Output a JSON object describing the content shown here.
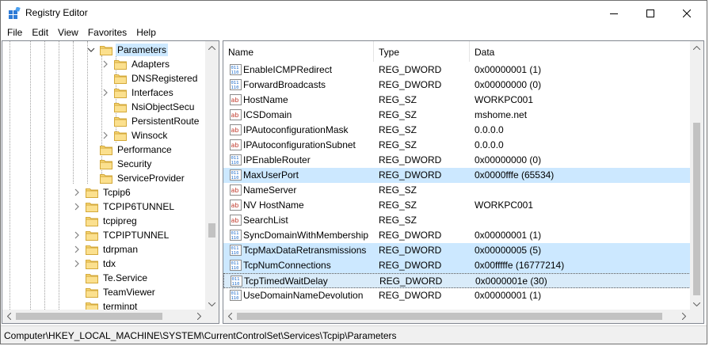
{
  "window": {
    "title": "Registry Editor"
  },
  "menubar": {
    "items": [
      {
        "accel": "F",
        "rest": "ile"
      },
      {
        "accel": "E",
        "rest": "dit"
      },
      {
        "accel": "V",
        "rest": "iew"
      },
      {
        "accel": "",
        "pre": "F",
        "accel2": "a",
        "rest": "vorites"
      },
      {
        "accel": "H",
        "rest": "elp"
      }
    ],
    "labels": [
      "File",
      "Edit",
      "View",
      "Favorites",
      "Help"
    ]
  },
  "tree": {
    "items": [
      {
        "label": "Parameters",
        "expanded": true,
        "selected": true
      },
      {
        "label": "Adapters",
        "expandable": true
      },
      {
        "label": "DNSRegistered",
        "expandable": false
      },
      {
        "label": "Interfaces",
        "expandable": true
      },
      {
        "label": "NsiObjectSecu",
        "expandable": false
      },
      {
        "label": "PersistentRoute",
        "expandable": false
      },
      {
        "label": "Winsock",
        "expandable": true
      },
      {
        "label": "Performance",
        "expandable": false
      },
      {
        "label": "Security",
        "expandable": false
      },
      {
        "label": "ServiceProvider",
        "expandable": false
      },
      {
        "label": "Tcpip6",
        "expandable": true
      },
      {
        "label": "TCPIP6TUNNEL",
        "expandable": true
      },
      {
        "label": "tcpipreg",
        "expandable": false
      },
      {
        "label": "TCPIPTUNNEL",
        "expandable": true
      },
      {
        "label": "tdrpman",
        "expandable": true
      },
      {
        "label": "tdx",
        "expandable": true
      },
      {
        "label": "Te.Service",
        "expandable": false
      },
      {
        "label": "TeamViewer",
        "expandable": false
      },
      {
        "label": "terminpt",
        "expandable": false
      }
    ]
  },
  "list": {
    "columns": [
      "Name",
      "Type",
      "Data"
    ],
    "rows": [
      {
        "icon": "dword",
        "name": "EnableICMPRedirect",
        "type": "REG_DWORD",
        "data": "0x00000001 (1)"
      },
      {
        "icon": "dword",
        "name": "ForwardBroadcasts",
        "type": "REG_DWORD",
        "data": "0x00000000 (0)"
      },
      {
        "icon": "string",
        "name": "HostName",
        "type": "REG_SZ",
        "data": "WORKPC001"
      },
      {
        "icon": "string",
        "name": "ICSDomain",
        "type": "REG_SZ",
        "data": "mshome.net"
      },
      {
        "icon": "string",
        "name": "IPAutoconfigurationMask",
        "type": "REG_SZ",
        "data": "0.0.0.0"
      },
      {
        "icon": "string",
        "name": "IPAutoconfigurationSubnet",
        "type": "REG_SZ",
        "data": "0.0.0.0"
      },
      {
        "icon": "dword",
        "name": "IPEnableRouter",
        "type": "REG_DWORD",
        "data": "0x00000000 (0)"
      },
      {
        "icon": "dword",
        "name": "MaxUserPort",
        "type": "REG_DWORD",
        "data": "0x0000fffe (65534)",
        "selected": true
      },
      {
        "icon": "string",
        "name": "NameServer",
        "type": "REG_SZ",
        "data": ""
      },
      {
        "icon": "string",
        "name": "NV HostName",
        "type": "REG_SZ",
        "data": "WORKPC001"
      },
      {
        "icon": "string",
        "name": "SearchList",
        "type": "REG_SZ",
        "data": ""
      },
      {
        "icon": "dword",
        "name": "SyncDomainWithMembership",
        "type": "REG_DWORD",
        "data": "0x00000001 (1)"
      },
      {
        "icon": "dword",
        "name": "TcpMaxDataRetransmissions",
        "type": "REG_DWORD",
        "data": "0x00000005 (5)",
        "selected": true
      },
      {
        "icon": "dword",
        "name": "TcpNumConnections",
        "type": "REG_DWORD",
        "data": "0x00fffffe (16777214)",
        "selected": true
      },
      {
        "icon": "dword",
        "name": "TcpTimedWaitDelay",
        "type": "REG_DWORD",
        "data": "0x0000001e (30)",
        "selected": true,
        "focused": true
      },
      {
        "icon": "dword",
        "name": "UseDomainNameDevolution",
        "type": "REG_DWORD",
        "data": "0x00000001 (1)"
      }
    ]
  },
  "statusbar": {
    "path": "Computer\\HKEY_LOCAL_MACHINE\\SYSTEM\\CurrentControlSet\\Services\\Tcpip\\Parameters"
  },
  "colors": {
    "selection": "#cce8ff",
    "folder": "#f8d775",
    "dword_icon": "#1b6ac9",
    "string_icon": "#c0392b"
  }
}
